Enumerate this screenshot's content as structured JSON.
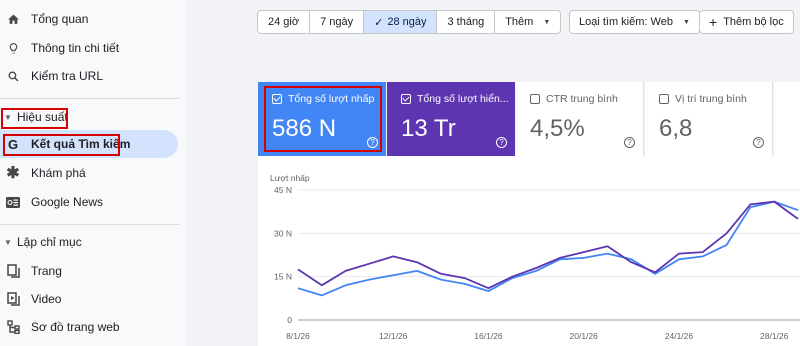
{
  "sidebar": {
    "items_top": [
      {
        "label": "Tổng quan",
        "icon": "home-icon"
      },
      {
        "label": "Thông tin chi tiết",
        "icon": "lightbulb-icon"
      },
      {
        "label": "Kiểm tra URL",
        "icon": "search-icon"
      }
    ],
    "performance_section": "Hiệu suất",
    "performance_items": [
      {
        "label": "Kết quả Tìm kiếm",
        "icon": "google-g-icon",
        "active": true
      },
      {
        "label": "Khám phá",
        "icon": "asterisk-icon"
      },
      {
        "label": "Google News",
        "icon": "google-news-icon"
      }
    ],
    "indexing_section": "Lập chỉ mục",
    "indexing_items": [
      {
        "label": "Trang",
        "icon": "pages-icon"
      },
      {
        "label": "Video",
        "icon": "video-icon"
      },
      {
        "label": "Sơ đồ trang web",
        "icon": "sitemap-icon"
      }
    ]
  },
  "toolbar": {
    "ranges": [
      "24 giờ",
      "7 ngày",
      "28 ngày",
      "3 tháng"
    ],
    "selected_range": "28 ngày",
    "more_label": "Thêm",
    "search_type_label": "Loại tìm kiếm: Web",
    "add_filter_label": "Thêm bộ lọc"
  },
  "metrics": {
    "clicks": {
      "label": "Tổng số lượt nhấp",
      "value": "586 N",
      "checked": true,
      "color": "#4285f4"
    },
    "impressions": {
      "label": "Tổng số lượt hiển...",
      "value": "13 Tr",
      "checked": true,
      "color": "#5e35b1"
    },
    "ctr": {
      "label": "CTR trung bình",
      "value": "4,5%",
      "checked": false
    },
    "position": {
      "label": "Vị trí trung bình",
      "value": "6,8",
      "checked": false
    },
    "help_glyph": "?"
  },
  "chart_data": {
    "type": "line",
    "ylabel": "Lượt nhấp",
    "y_ticks": [
      "45 N",
      "30 N",
      "15 N",
      "0"
    ],
    "ylim": [
      0,
      45
    ],
    "x_ticks": [
      "8/1/26",
      "12/1/26",
      "16/1/26",
      "20/1/26",
      "24/1/26",
      "28/1/26"
    ],
    "x_tick_index": [
      0,
      4,
      8,
      12,
      16,
      20
    ],
    "grid": true,
    "series": [
      {
        "color": "#4285f4",
        "values": [
          11,
          8.5,
          12,
          14,
          15.5,
          17,
          14,
          12.5,
          10,
          14.5,
          17,
          21,
          21.5,
          23,
          21,
          16,
          21,
          22,
          26,
          39,
          41,
          38
        ]
      },
      {
        "color": "#5e35b1",
        "values": [
          17.5,
          12,
          17,
          19.5,
          22,
          20,
          16,
          14.5,
          11,
          15,
          18,
          21.5,
          23.5,
          25.5,
          20,
          16.5,
          23,
          23.5,
          30,
          40,
          41,
          35
        ]
      }
    ]
  }
}
